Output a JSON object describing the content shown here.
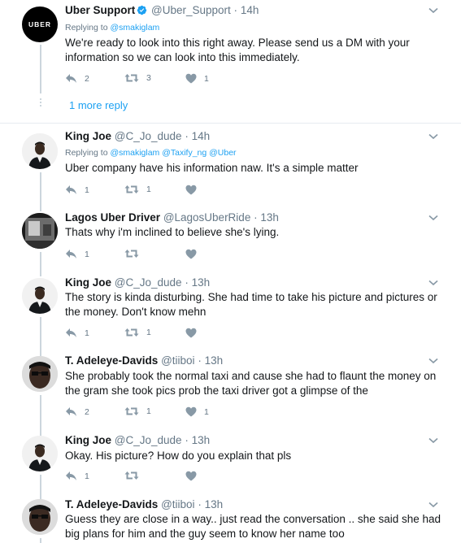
{
  "tweets": [
    {
      "name": "Uber Support",
      "handle": "@Uber_Support",
      "time": "14h",
      "verified": true,
      "replying_label": "Replying to",
      "replying_mentions": "@smakiglam",
      "text": "We're ready to look into this right away. Please send us a DM with your information so we can look into this immediately.",
      "replies": "2",
      "retweets": "3",
      "likes": "1",
      "avatar_logo_text": "UBER"
    },
    {
      "name": "King Joe",
      "handle": "@C_Jo_dude",
      "time": "14h",
      "replying_label": "Replying to",
      "replying_mentions": "@smakiglam @Taxify_ng @Uber",
      "text": "Uber company have his information naw. It's a simple matter",
      "replies": "1",
      "retweets": "1",
      "likes": ""
    },
    {
      "name": "Lagos Uber Driver",
      "handle": "@LagosUberRide",
      "time": "13h",
      "text": "Thats why i'm inclined to believe she's lying.",
      "replies": "1",
      "retweets": "",
      "likes": ""
    },
    {
      "name": "King Joe",
      "handle": "@C_Jo_dude",
      "time": "13h",
      "text": "The story is kinda disturbing. She had time to take his picture and pictures or the money. Don't know mehn",
      "replies": "1",
      "retweets": "1",
      "likes": ""
    },
    {
      "name": "T. Adeleye-Davids",
      "handle": "@tiiboi",
      "time": "13h",
      "text": "She probably took the normal taxi and cause she had to flaunt the money on the gram she took pics prob the taxi driver got a glimpse of the",
      "replies": "2",
      "retweets": "1",
      "likes": "1"
    },
    {
      "name": "King Joe",
      "handle": "@C_Jo_dude",
      "time": "13h",
      "text": "Okay. His picture? How do you explain that pls",
      "replies": "1",
      "retweets": "",
      "likes": ""
    },
    {
      "name": "T. Adeleye-Davids",
      "handle": "@tiiboi",
      "time": "13h",
      "text": "Guess they are close in a way.. just read the conversation .. she said she had big plans for him and the guy seem to know her name too",
      "replies": "",
      "retweets": "",
      "likes": ""
    }
  ],
  "more_replies_label": "1 more reply",
  "colors": {
    "accent": "#1da1f2",
    "secondary_text": "#657786",
    "thread_line": "#ccd6dd",
    "divider": "#e6ecf0"
  },
  "icons": {
    "reply": "reply-icon",
    "retweet": "retweet-icon",
    "like": "heart-icon",
    "caret": "chevron-down-icon",
    "verified": "verified-badge-icon"
  }
}
